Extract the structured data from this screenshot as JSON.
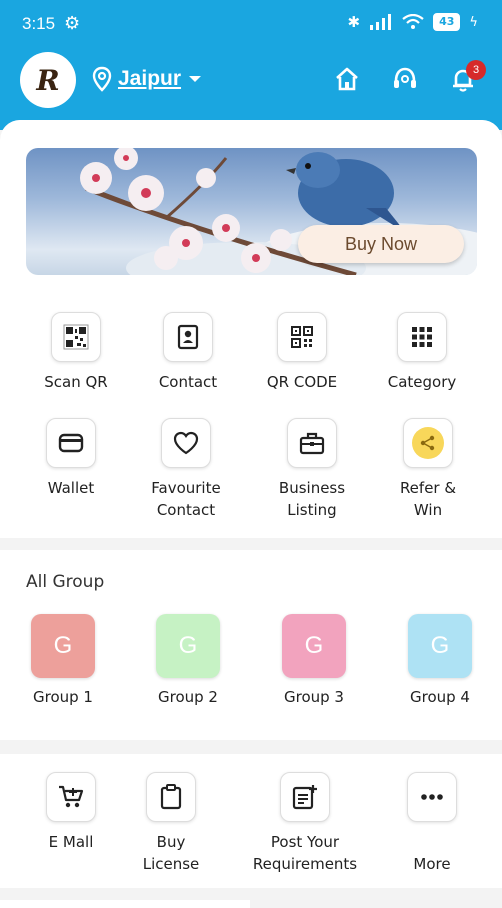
{
  "status_bar": {
    "time": "3:15",
    "battery": "43"
  },
  "header": {
    "logo_letter": "R",
    "city": "Jaipur",
    "notification_count": "3"
  },
  "banner": {
    "cta_label": "Buy Now"
  },
  "quick_actions": [
    {
      "label": "Scan QR",
      "icon": "qr-scan-icon"
    },
    {
      "label": "Contact",
      "icon": "contact-icon"
    },
    {
      "label": "QR CODE",
      "icon": "qr-code-icon"
    },
    {
      "label": "Category",
      "icon": "grid-icon"
    },
    {
      "label": "Wallet",
      "icon": "wallet-icon"
    },
    {
      "label": "Favourite Contact",
      "icon": "heart-icon"
    },
    {
      "label": "Business Listing",
      "icon": "briefcase-icon"
    },
    {
      "label": "Refer & Win",
      "icon": "share-icon"
    }
  ],
  "groups_section": {
    "title": "All Group",
    "groups": [
      {
        "label": "Group 1",
        "letter": "G",
        "color": "#eda09b"
      },
      {
        "label": "Group 2",
        "letter": "G",
        "color": "#c6f2c4"
      },
      {
        "label": "Group 3",
        "letter": "G",
        "color": "#f2a3be"
      },
      {
        "label": "Group 4",
        "letter": "G",
        "color": "#aee2f4"
      }
    ]
  },
  "bottom_actions": [
    {
      "label": "E Mall",
      "icon": "cart-icon"
    },
    {
      "label": "Buy License",
      "icon": "clipboard-icon"
    },
    {
      "label": "Post Your Requirements",
      "icon": "post-icon"
    },
    {
      "label": "More",
      "icon": "more-icon"
    }
  ],
  "colors": {
    "primary": "#1aa6e0",
    "badge": "#d62a2a"
  }
}
